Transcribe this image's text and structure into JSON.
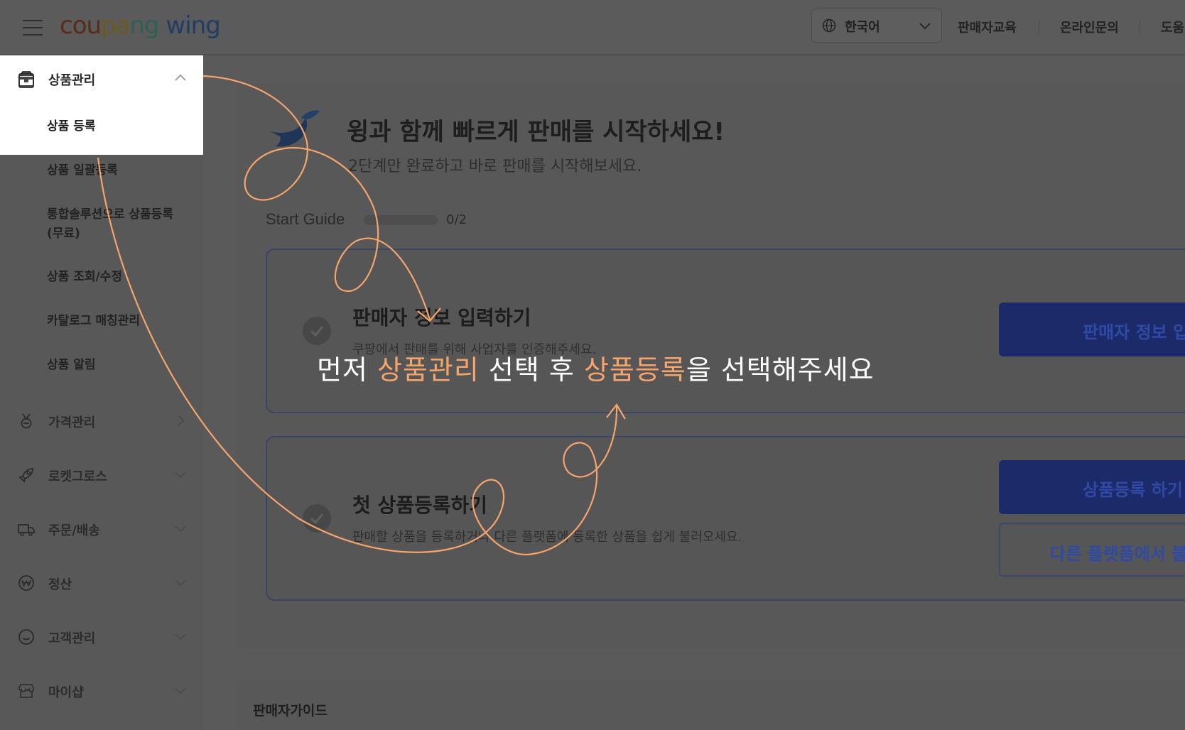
{
  "header": {
    "logo": "coupang wing",
    "language": "한국어",
    "links": [
      "판매자교육",
      "온라인문의",
      "도움"
    ]
  },
  "sidebar": {
    "product_mgmt": {
      "label": "상품관리",
      "items": [
        "상품 등록",
        "상품 일괄등록",
        "통합솔루션으로 상품등록",
        "(무료)",
        "상품 조회/수정",
        "카탈로그 매칭관리",
        "상품 알림"
      ]
    },
    "sections": [
      "가격관리",
      "로켓그로스",
      "주문/배송",
      "정산",
      "고객관리",
      "마이샵"
    ],
    "icons": [
      "box-icon",
      "medal-icon",
      "rocket-icon",
      "truck-icon",
      "won-icon",
      "smile-icon",
      "shop-icon"
    ]
  },
  "main": {
    "hero_title": "윙과 함께 빠르게 판매를 시작하세요!",
    "hero_subtitle": "2단계만 완료하고 바로 판매를 시작해보세요.",
    "start_guide_label": "Start Guide",
    "start_guide_progress": "0/2",
    "steps": [
      {
        "title": "판매자 정보 입력하기",
        "desc": "쿠팡에서 판매를 위해 사업자를 인증해주세요.",
        "button": "판매자 정보 입"
      },
      {
        "title": "첫 상품등록하기",
        "desc": "판매할 상품을 등록하거나 다른 플랫폼에 등록한 상품을 쉽게 불러오세요.",
        "button_primary": "상품등록 하기",
        "button_secondary": "다른 플랫폼에서 불"
      }
    ],
    "seller_guide": "판매자가이드"
  },
  "overlay": {
    "part1": "먼저 ",
    "highlight1": "상품관리",
    "part2": " 선택 후 ",
    "highlight2": "상품등록",
    "part3": "을 선택해주세요",
    "highlight_color": "#f5a46b",
    "arrow_color": "#f5a46b"
  }
}
